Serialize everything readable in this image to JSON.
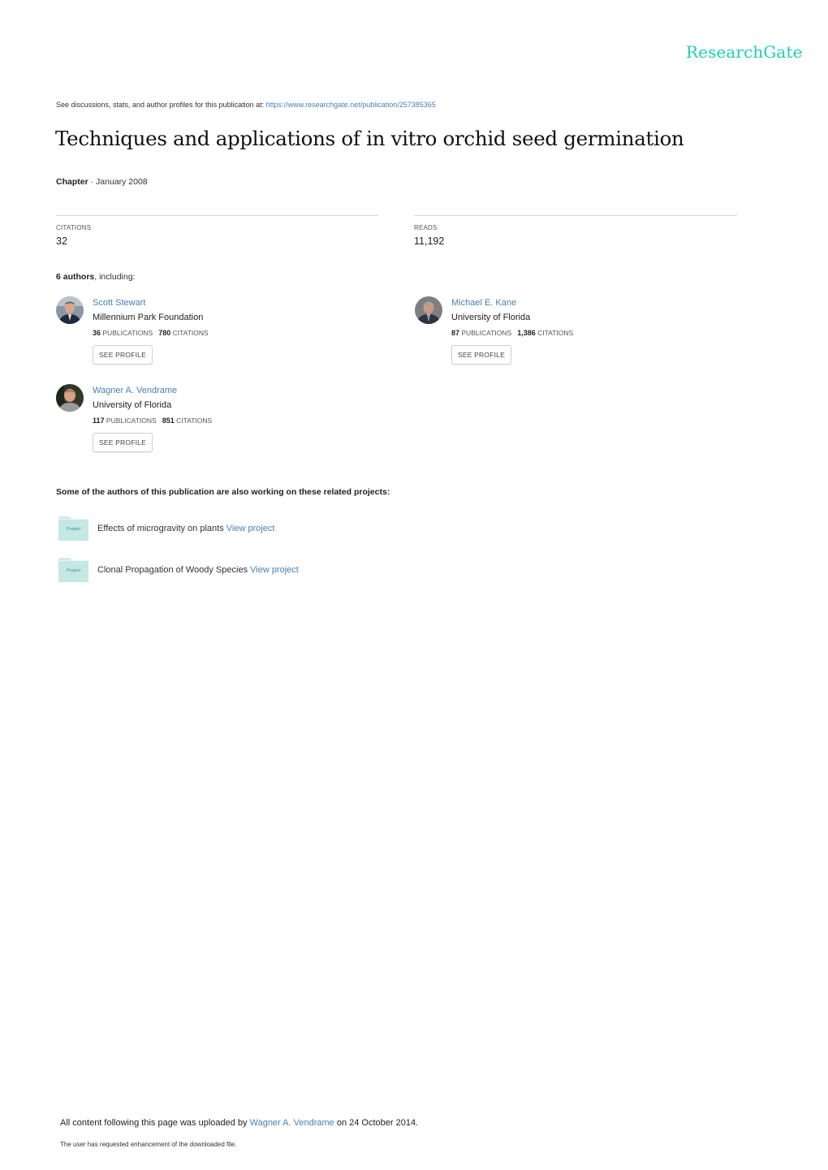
{
  "brand": {
    "name": "ResearchGate",
    "color": "#1ad0b4"
  },
  "header": {
    "see_discussions_prefix": "See discussions, stats, and author profiles for this publication at: ",
    "publication_url": "https://www.researchgate.net/publication/257385365"
  },
  "publication": {
    "title": "Techniques and applications of in vitro orchid seed germination",
    "type": "Chapter",
    "date_separator": " · ",
    "date": "January 2008"
  },
  "stats": {
    "citations_label": "CITATIONS",
    "citations_value": "32",
    "reads_label": "READS",
    "reads_value": "11,192"
  },
  "authors_section": {
    "count_label": "6 authors",
    "suffix": ", including:",
    "see_profile_label": "SEE PROFILE",
    "publications_label": "PUBLICATIONS",
    "citations_label": "CITATIONS",
    "authors": [
      {
        "name": "Scott Stewart",
        "institution": "Millennium Park Foundation",
        "publications": "36",
        "citations": "780"
      },
      {
        "name": "Michael E. Kane",
        "institution": "University of Florida",
        "publications": "87",
        "citations": "1,386"
      },
      {
        "name": "Wagner A. Vendrame",
        "institution": "University of Florida",
        "publications": "117",
        "citations": "851"
      }
    ]
  },
  "projects_section": {
    "heading": "Some of the authors of this publication are also working on these related projects:",
    "folder_label": "Project",
    "view_label": "View project",
    "projects": [
      {
        "title": "Effects of microgravity on plants"
      },
      {
        "title": "Clonal Propagation of Woody Species"
      }
    ]
  },
  "footer": {
    "uploaded_prefix": "All content following this page was uploaded by ",
    "uploader": "Wagner A. Vendrame",
    "uploaded_suffix": " on 24 October 2014.",
    "enhancement_note": "The user has requested enhancement of the downloaded file."
  },
  "colors": {
    "link": "#4a7fb0",
    "folder": "#c4e8e6"
  }
}
